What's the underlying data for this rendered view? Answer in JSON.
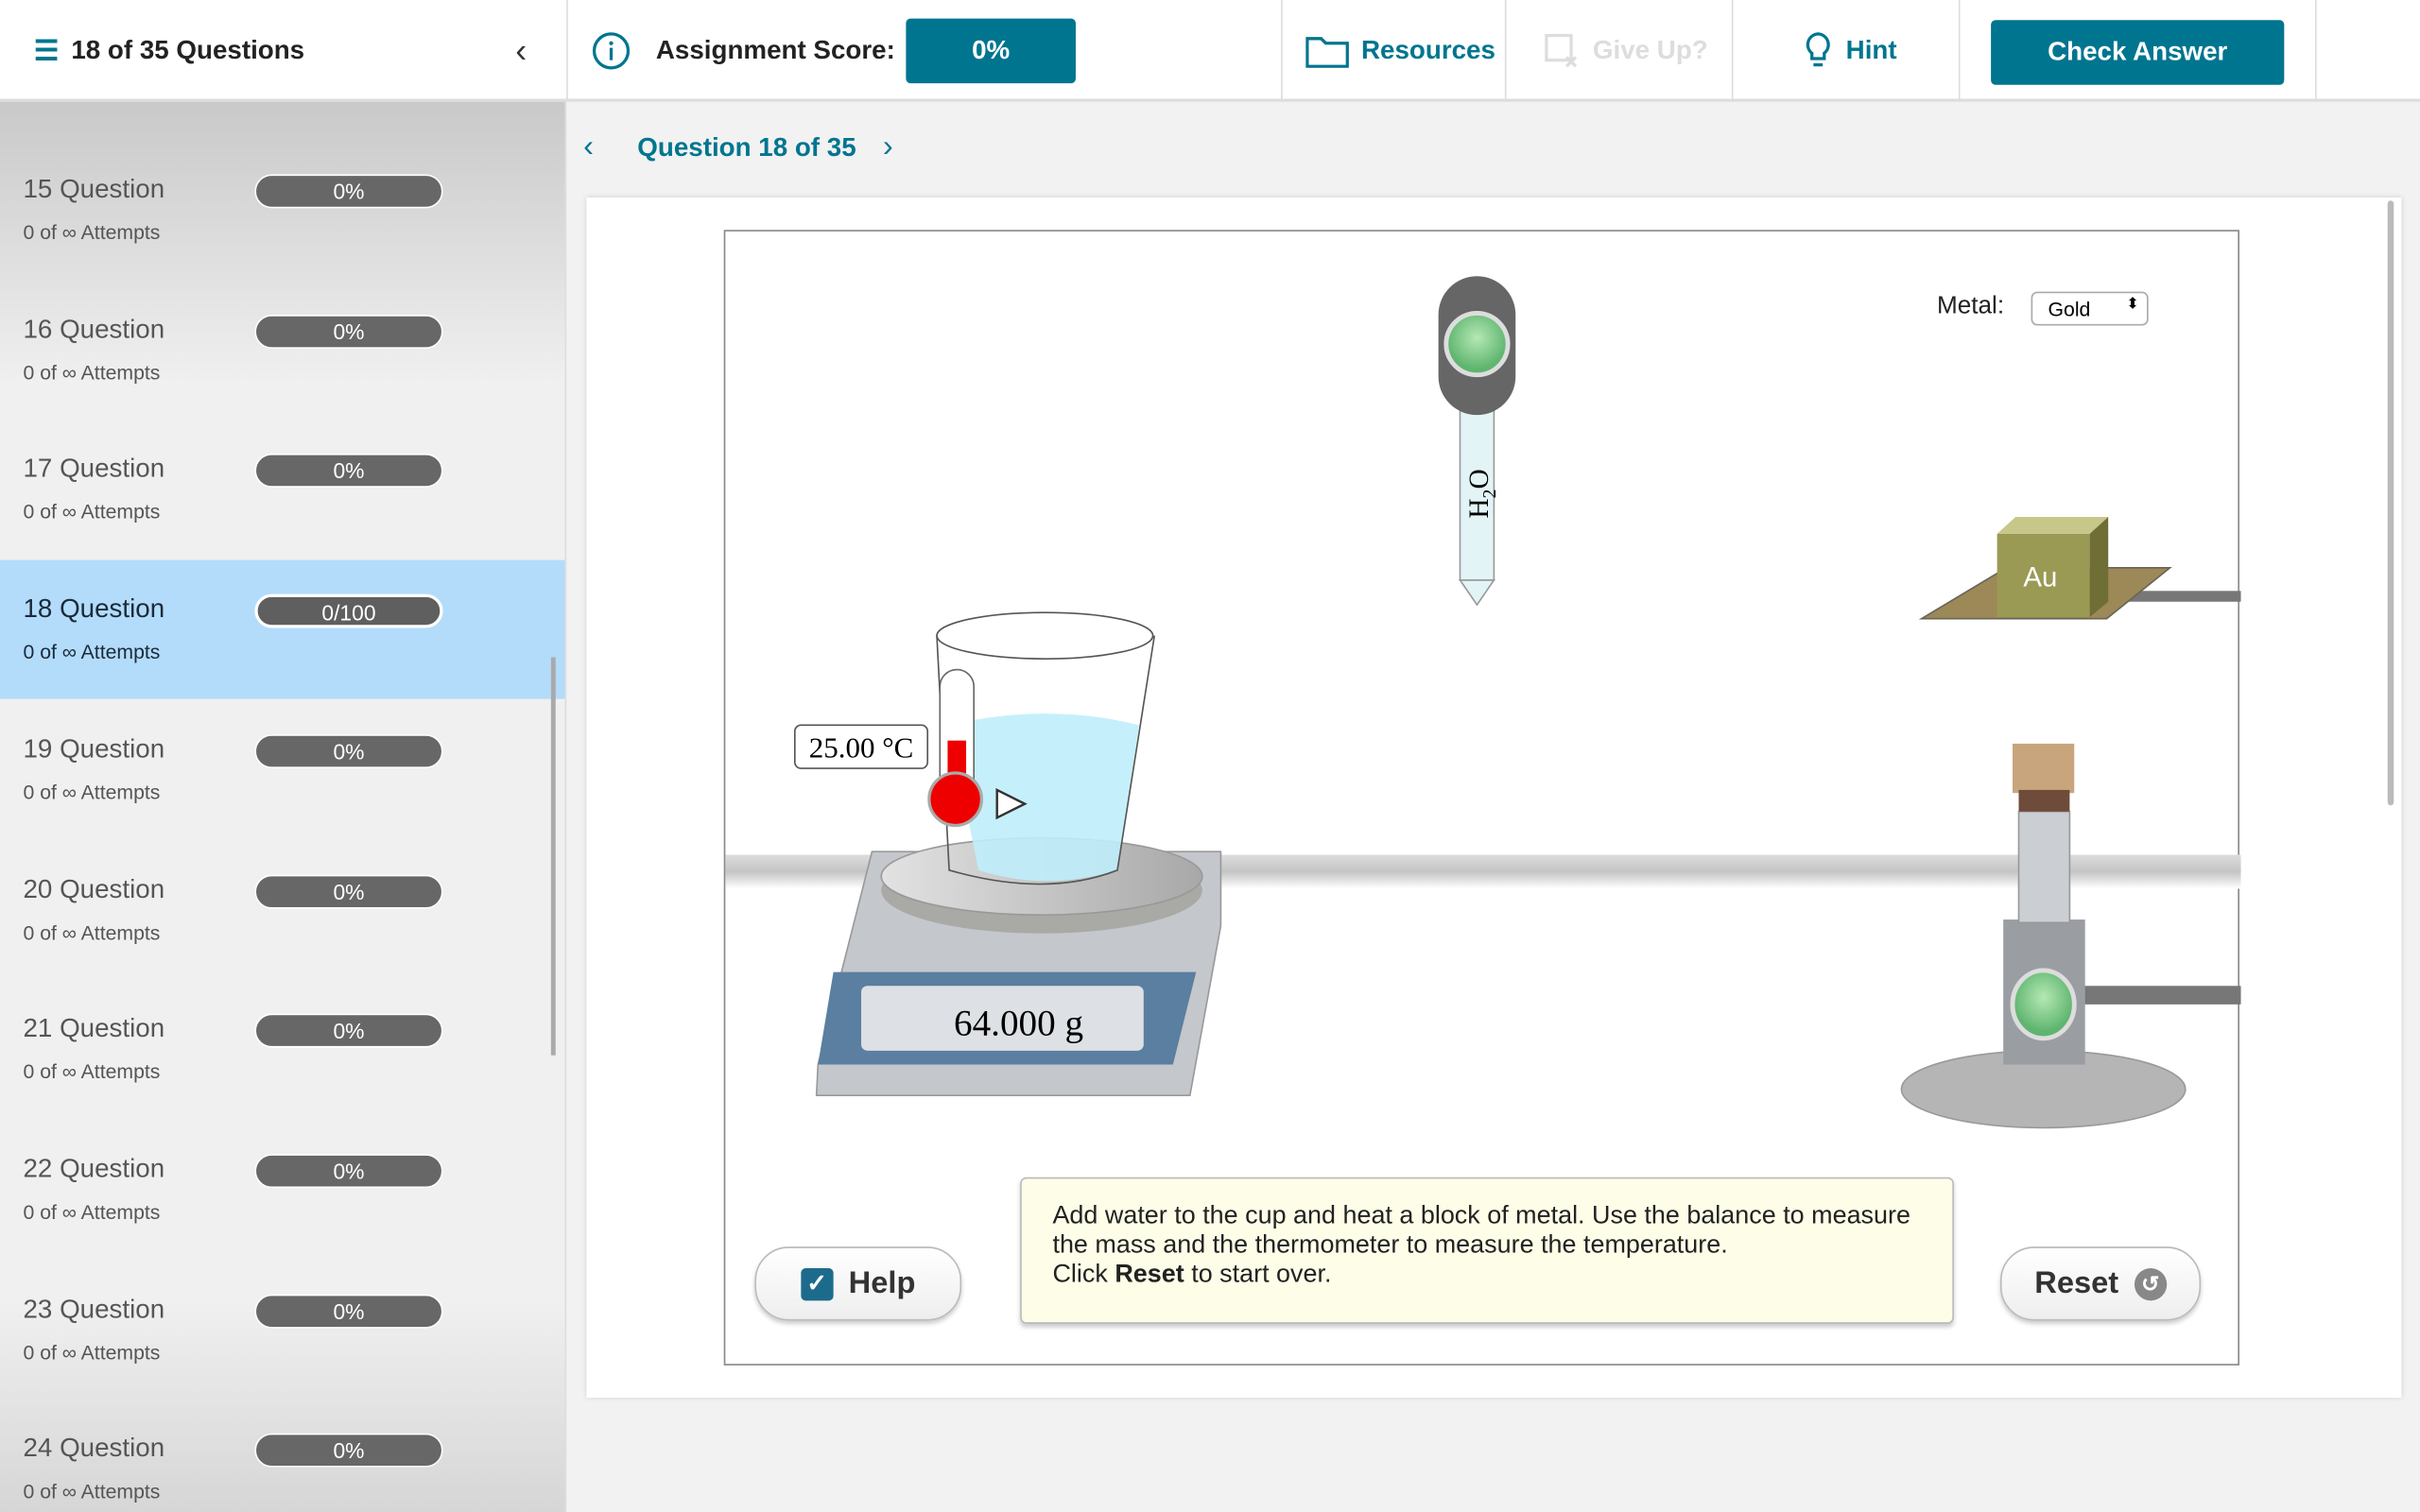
{
  "header": {
    "questions_label": "18 of 35 Questions",
    "score_label": "Assignment Score:",
    "score_value": "0%",
    "resources": "Resources",
    "give_up": "Give Up?",
    "hint": "Hint",
    "check_answer": "Check Answer"
  },
  "nav": {
    "title": "Question 18 of 35"
  },
  "sidebar": {
    "items": [
      {
        "title": "15 Question",
        "attempts": "0 of ∞ Attempts",
        "score": "0%"
      },
      {
        "title": "16 Question",
        "attempts": "0 of ∞ Attempts",
        "score": "0%"
      },
      {
        "title": "17 Question",
        "attempts": "0 of ∞ Attempts",
        "score": "0%"
      },
      {
        "title": "18 Question",
        "attempts": "0 of ∞ Attempts",
        "score": "0/100",
        "selected": true
      },
      {
        "title": "19 Question",
        "attempts": "0 of ∞ Attempts",
        "score": "0%"
      },
      {
        "title": "20 Question",
        "attempts": "0 of ∞ Attempts",
        "score": "0%"
      },
      {
        "title": "21 Question",
        "attempts": "0 of ∞ Attempts",
        "score": "0%"
      },
      {
        "title": "22 Question",
        "attempts": "0 of ∞ Attempts",
        "score": "0%"
      },
      {
        "title": "23 Question",
        "attempts": "0 of ∞ Attempts",
        "score": "0%"
      },
      {
        "title": "24 Question",
        "attempts": "0 of ∞ Attempts",
        "score": "0%"
      }
    ]
  },
  "sim": {
    "metal_label": "Metal:",
    "metal_value": "Gold",
    "dropper_label": "H2O",
    "block_label": "Au",
    "temperature": "25.00 °C",
    "mass": "64.000 g",
    "help": "Help",
    "reset": "Reset",
    "instructions_1": "Add water to the cup and heat a block of metal. Use the balance to measure the mass and the thermometer to measure the temperature.",
    "instructions_2": "Click ",
    "instructions_bold": "Reset",
    "instructions_3": " to start over."
  },
  "colors": {
    "accent": "#00758f",
    "selected": "#b3dcfb"
  }
}
